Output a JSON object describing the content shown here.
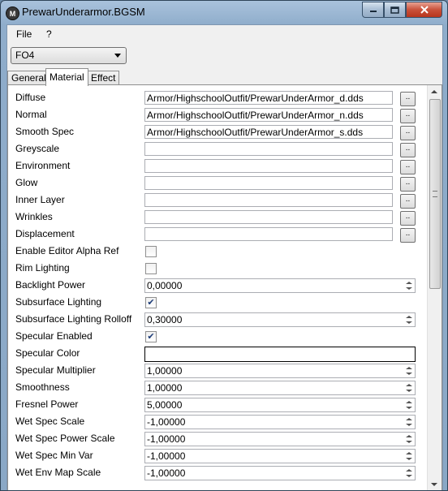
{
  "window": {
    "title": "PrewarUnderarmor.BGSM",
    "app_icon_letter": "M"
  },
  "menu": {
    "file": "File",
    "help": "?"
  },
  "game_select": {
    "selected": "FO4"
  },
  "tabs": [
    "General",
    "Material",
    "Effect"
  ],
  "active_tab": "Material",
  "texture_rows": [
    {
      "label": "Diffuse",
      "value": "Armor/HighschoolOutfit/PrewarUnderArmor_d.dds",
      "button": ".."
    },
    {
      "label": "Normal",
      "value": "Armor/HighschoolOutfit/PrewarUnderArmor_n.dds",
      "button": ".."
    },
    {
      "label": "Smooth Spec",
      "value": "Armor/HighschoolOutfit/PrewarUnderArmor_s.dds",
      "button": ".."
    },
    {
      "label": "Greyscale",
      "value": "",
      "button": ".."
    },
    {
      "label": "Environment",
      "value": "",
      "button": ".."
    },
    {
      "label": "Glow",
      "value": "",
      "button": ".."
    },
    {
      "label": "Inner Layer",
      "value": "",
      "button": ".."
    },
    {
      "label": "Wrinkles",
      "value": "",
      "button": ".."
    },
    {
      "label": "Displacement",
      "value": "",
      "button": ".."
    }
  ],
  "property_rows": [
    {
      "label": "Enable Editor Alpha Ref",
      "kind": "checkbox",
      "checked": false
    },
    {
      "label": "Rim Lighting",
      "kind": "checkbox",
      "checked": false
    },
    {
      "label": "Backlight Power",
      "kind": "number",
      "value": "0,00000"
    },
    {
      "label": "Subsurface Lighting",
      "kind": "checkbox",
      "checked": true
    },
    {
      "label": "Subsurface Lighting Rolloff",
      "kind": "number",
      "value": "0,30000"
    },
    {
      "label": "Specular Enabled",
      "kind": "checkbox",
      "checked": true
    },
    {
      "label": "Specular Color",
      "kind": "color",
      "value": ""
    },
    {
      "label": "Specular Multiplier",
      "kind": "number",
      "value": "1,00000"
    },
    {
      "label": "Smoothness",
      "kind": "number",
      "value": "1,00000"
    },
    {
      "label": "Fresnel Power",
      "kind": "number",
      "value": "5,00000"
    },
    {
      "label": "Wet Spec Scale",
      "kind": "number",
      "value": "-1,00000"
    },
    {
      "label": "Wet Spec Power Scale",
      "kind": "number",
      "value": "-1,00000"
    },
    {
      "label": "Wet Spec Min Var",
      "kind": "number",
      "value": "-1,00000"
    },
    {
      "label": "Wet Env Map Scale",
      "kind": "number",
      "value": "-1,00000"
    }
  ],
  "checkmark_glyph": "✔"
}
